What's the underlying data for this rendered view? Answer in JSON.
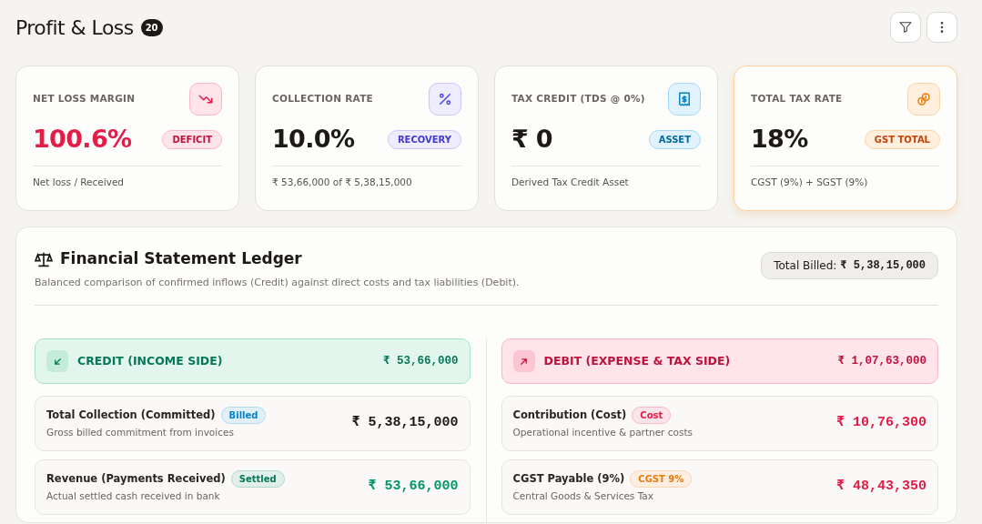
{
  "header": {
    "title": "Profit & Loss",
    "count": "20"
  },
  "toolbar": [
    {
      "kind": "filter"
    },
    {
      "kind": "more"
    }
  ],
  "cards": [
    {
      "kind": "loss",
      "selected": false,
      "label": "NET LOSS MARGIN",
      "value": "100.6%",
      "badge": "DEFICIT",
      "note": "Net loss / Received"
    },
    {
      "kind": "rate",
      "selected": false,
      "label": "COLLECTION RATE",
      "value": "10.0%",
      "badge": "RECOVERY",
      "note": "₹ 53,66,000 of ₹ 5,38,15,000"
    },
    {
      "kind": "credit",
      "selected": false,
      "label": "TAX CREDIT (TDS @ 0%)",
      "value": "₹ 0",
      "badge": "ASSET",
      "note": "Derived Tax Credit Asset"
    },
    {
      "kind": "tax",
      "selected": true,
      "label": "TOTAL TAX RATE",
      "value": "18%",
      "badge": "GST TOTAL",
      "note": "CGST (9%) + SGST (9%)"
    }
  ],
  "ledger": {
    "title": "Financial Statement Ledger",
    "subtitle": "Balanced comparison of confirmed inflows (Credit) against direct costs and tax liabilities (Debit).",
    "total_label": "Total Billed:",
    "total_value": "₹ 5,38,15,000",
    "sides": [
      {
        "kind": "credit",
        "title": "CREDIT (INCOME SIDE)",
        "total": "₹ 53,66,000",
        "rows": [
          {
            "kind": "neutral",
            "title": "Total Collection (Committed)",
            "tag": {
              "label": "Billed",
              "color": "#0284c7"
            },
            "note": "Gross billed commitment from invoices",
            "amount": "₹ 5,38,15,000"
          },
          {
            "kind": "income",
            "title": "Revenue (Payments Received)",
            "tag": {
              "label": "Settled",
              "color": "#047857"
            },
            "note": "Actual settled cash received in bank",
            "amount": "₹ 53,66,000"
          }
        ]
      },
      {
        "kind": "debit",
        "title": "DEBIT (EXPENSE & TAX SIDE)",
        "total": "₹ 1,07,63,000",
        "rows": [
          {
            "kind": "expense",
            "title": "Contribution (Cost)",
            "tag": {
              "label": "Cost",
              "color": "#e11d48"
            },
            "note": "Operational incentive & partner costs",
            "amount": "₹ 10,76,300"
          },
          {
            "kind": "expense",
            "title": "CGST Payable (9%)",
            "tag": {
              "label": "CGST 9%",
              "color": "#ea7a0c"
            },
            "note": "Central Goods & Services Tax",
            "amount": "₹ 48,43,350"
          }
        ]
      }
    ]
  }
}
